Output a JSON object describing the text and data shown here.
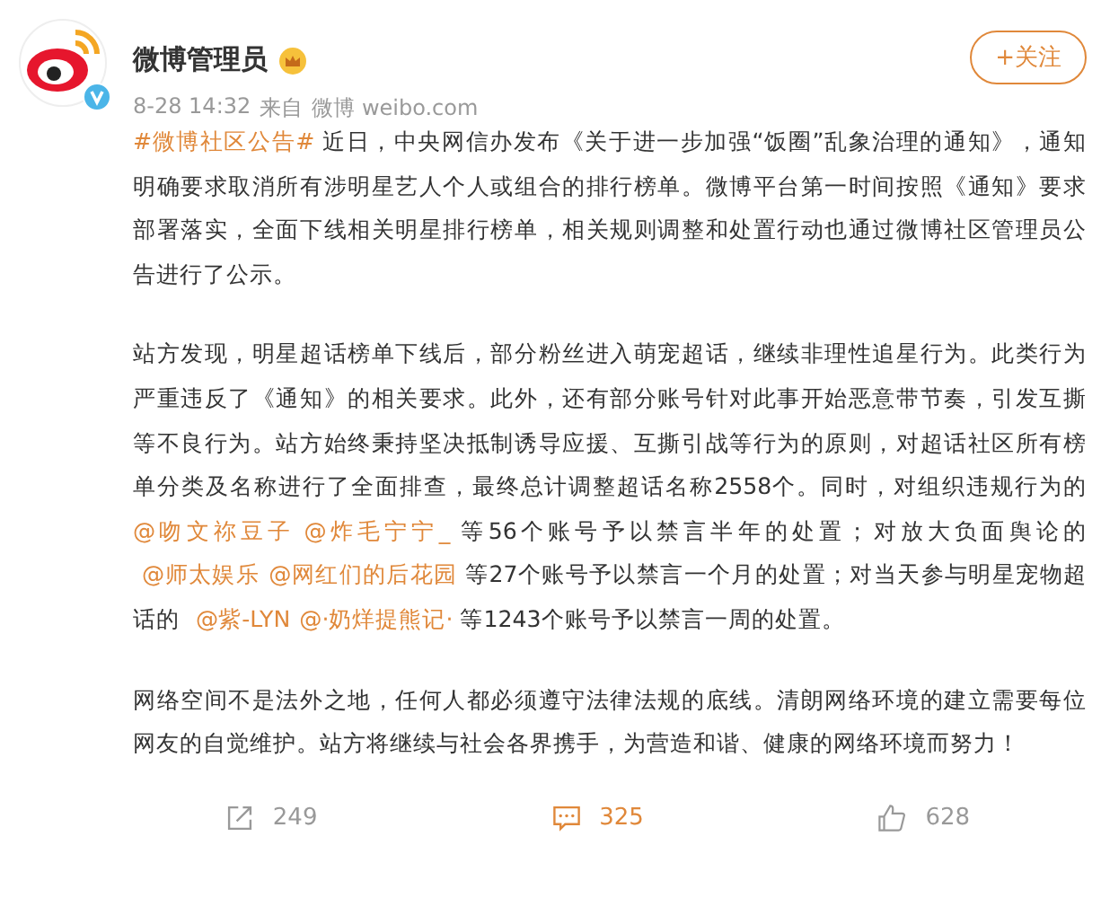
{
  "post": {
    "author": "微博管理员",
    "verified": true,
    "time": "8-28 14:32",
    "source_prefix": "来自",
    "source": "微博 weibo.com",
    "follow_label": "+关注"
  },
  "paragraphs": [
    [
      {
        "kind": "link",
        "text": "#微博社区公告#"
      },
      {
        "kind": "text",
        "text": " 近日，中央网信办发布《关于进一步加强“饭圈”乱象治理的通知》，通知明确要求取消所有涉明星艺人个人或组合的排行榜单。微博平台第一时间按照《通知》要求部署落实，全面下线相关明星排行榜单，相关规则调整和处置行动也通过微博社区管理员公告进行了公示。"
      }
    ],
    [
      {
        "kind": "text",
        "text": "站方发现，明星超话榜单下线后，部分粉丝进入萌宠超话，继续非理性追星行为。此类行为严重违反了《通知》的相关要求。此外，还有部分账号针对此事开始恶意带节奏，引发互撕等不良行为。站方始终秉持坚决抵制诱导应援、互撕引战等行为的原则，对超话社区所有榜单分类及名称进行了全面排查，最终总计调整超话名称2558个。同时，对组织违规行为的 "
      },
      {
        "kind": "link",
        "text": "@吻文祢豆子"
      },
      {
        "kind": "link",
        "text": "@炸毛宁宁_"
      },
      {
        "kind": "text",
        "text": " 等56个账号予以禁言半年的处置；对放大负面舆论的 "
      },
      {
        "kind": "link",
        "text": "@师太娱乐"
      },
      {
        "kind": "link",
        "text": "@网红们的后花园"
      },
      {
        "kind": "text",
        "text": " 等27个账号予以禁言一个月的处置；对当天参与明星宠物超话的 "
      },
      {
        "kind": "link",
        "text": "@紫-LYN"
      },
      {
        "kind": "link",
        "text": "@·奶烊提熊记·"
      },
      {
        "kind": "text",
        "text": " 等1243个账号予以禁言一周的处置。"
      }
    ],
    [
      {
        "kind": "text",
        "text": "网络空间不是法外之地，任何人都必须遵守法律法规的底线。清朗网络环境的建立需要每位网友的自觉维护。站方将继续与社会各界携手，为营造和谐、健康的网络环境而努力！"
      }
    ]
  ],
  "actions": [
    {
      "kind": "share",
      "count": "249",
      "color": "#999999"
    },
    {
      "kind": "comment",
      "count": "325",
      "color": "#e0883a"
    },
    {
      "kind": "like",
      "count": "628",
      "color": "#999999"
    }
  ]
}
